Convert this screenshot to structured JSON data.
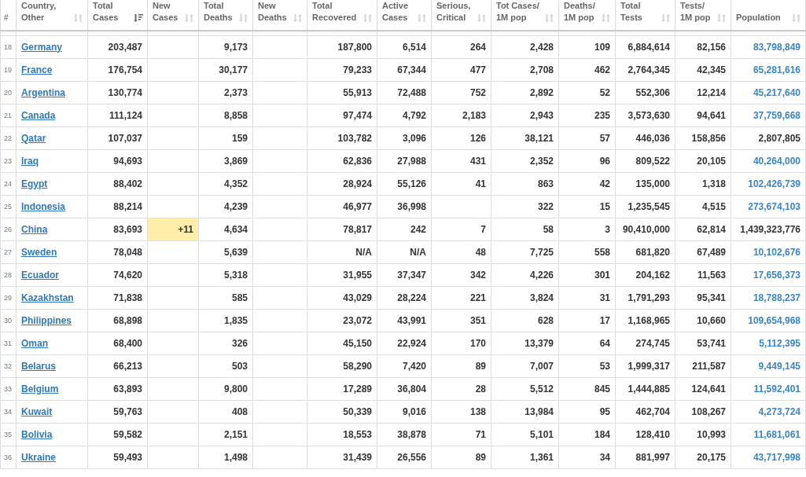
{
  "table": {
    "columns": [
      {
        "lines": [
          "#"
        ],
        "kind": "index"
      },
      {
        "lines": [
          "Country,",
          "Other"
        ],
        "kind": "data",
        "sorted": false
      },
      {
        "lines": [
          "Total",
          "Cases"
        ],
        "kind": "data",
        "sorted": true
      },
      {
        "lines": [
          "New",
          "Cases"
        ],
        "kind": "data",
        "sorted": false
      },
      {
        "lines": [
          "Total",
          "Deaths"
        ],
        "kind": "data",
        "sorted": false
      },
      {
        "lines": [
          "New",
          "Deaths"
        ],
        "kind": "data",
        "sorted": false
      },
      {
        "lines": [
          "Total",
          "Recovered"
        ],
        "kind": "data",
        "sorted": false
      },
      {
        "lines": [
          "Active",
          "Cases"
        ],
        "kind": "data",
        "sorted": false
      },
      {
        "lines": [
          "Serious,",
          "Critical"
        ],
        "kind": "data",
        "sorted": false
      },
      {
        "lines": [
          "Tot Cases/",
          "1M pop"
        ],
        "kind": "data",
        "sorted": false
      },
      {
        "lines": [
          "Deaths/",
          "1M pop"
        ],
        "kind": "data",
        "sorted": false
      },
      {
        "lines": [
          "Total",
          "Tests"
        ],
        "kind": "data",
        "sorted": false
      },
      {
        "lines": [
          "Tests/",
          "1M pop"
        ],
        "kind": "data",
        "sorted": false
      },
      {
        "lines": [
          "Population"
        ],
        "kind": "data",
        "sorted": false
      }
    ],
    "rows": [
      {
        "rank": "18",
        "country": "Germany",
        "total_cases": "203,487",
        "total_deaths": "9,173",
        "total_recovered": "187,800",
        "active_cases": "6,514",
        "serious_critical": "264",
        "cases_per_1m": "2,428",
        "deaths_per_1m": "109",
        "total_tests": "6,884,614",
        "tests_per_1m": "82,156",
        "population": "83,798,849",
        "population_link": true
      },
      {
        "rank": "19",
        "country": "France",
        "total_cases": "176,754",
        "total_deaths": "30,177",
        "total_recovered": "79,233",
        "active_cases": "67,344",
        "serious_critical": "477",
        "cases_per_1m": "2,708",
        "deaths_per_1m": "462",
        "total_tests": "2,764,345",
        "tests_per_1m": "42,345",
        "population": "65,281,616",
        "population_link": true
      },
      {
        "rank": "20",
        "country": "Argentina",
        "total_cases": "130,774",
        "total_deaths": "2,373",
        "total_recovered": "55,913",
        "active_cases": "72,488",
        "serious_critical": "752",
        "cases_per_1m": "2,892",
        "deaths_per_1m": "52",
        "total_tests": "552,306",
        "tests_per_1m": "12,214",
        "population": "45,217,640",
        "population_link": true
      },
      {
        "rank": "21",
        "country": "Canada",
        "total_cases": "111,124",
        "total_deaths": "8,858",
        "total_recovered": "97,474",
        "active_cases": "4,792",
        "serious_critical": "2,183",
        "cases_per_1m": "2,943",
        "deaths_per_1m": "235",
        "total_tests": "3,573,630",
        "tests_per_1m": "94,641",
        "population": "37,759,668",
        "population_link": true
      },
      {
        "rank": "22",
        "country": "Qatar",
        "total_cases": "107,037",
        "total_deaths": "159",
        "total_recovered": "103,782",
        "active_cases": "3,096",
        "serious_critical": "126",
        "cases_per_1m": "38,121",
        "deaths_per_1m": "57",
        "total_tests": "446,036",
        "tests_per_1m": "158,856",
        "population": "2,807,805",
        "population_link": false
      },
      {
        "rank": "23",
        "country": "Iraq",
        "total_cases": "94,693",
        "total_deaths": "3,869",
        "total_recovered": "62,836",
        "active_cases": "27,988",
        "serious_critical": "431",
        "cases_per_1m": "2,352",
        "deaths_per_1m": "96",
        "total_tests": "809,522",
        "tests_per_1m": "20,105",
        "population": "40,264,000",
        "population_link": true
      },
      {
        "rank": "24",
        "country": "Egypt",
        "total_cases": "88,402",
        "total_deaths": "4,352",
        "total_recovered": "28,924",
        "active_cases": "55,126",
        "serious_critical": "41",
        "cases_per_1m": "863",
        "deaths_per_1m": "42",
        "total_tests": "135,000",
        "tests_per_1m": "1,318",
        "population": "102,426,739",
        "population_link": true
      },
      {
        "rank": "25",
        "country": "Indonesia",
        "total_cases": "88,214",
        "total_deaths": "4,239",
        "total_recovered": "46,977",
        "active_cases": "36,998",
        "cases_per_1m": "322",
        "deaths_per_1m": "15",
        "total_tests": "1,235,545",
        "tests_per_1m": "4,515",
        "population": "273,674,103",
        "population_link": true
      },
      {
        "rank": "26",
        "country": "China",
        "total_cases": "83,693",
        "new_cases": "+11",
        "total_deaths": "4,634",
        "total_recovered": "78,817",
        "active_cases": "242",
        "serious_critical": "7",
        "cases_per_1m": "58",
        "deaths_per_1m": "3",
        "total_tests": "90,410,000",
        "tests_per_1m": "62,814",
        "population": "1,439,323,776",
        "population_link": false
      },
      {
        "rank": "27",
        "country": "Sweden",
        "total_cases": "78,048",
        "total_deaths": "5,639",
        "total_recovered": "N/A",
        "active_cases": "N/A",
        "serious_critical": "48",
        "cases_per_1m": "7,725",
        "deaths_per_1m": "558",
        "total_tests": "681,820",
        "tests_per_1m": "67,489",
        "population": "10,102,676",
        "population_link": true
      },
      {
        "rank": "28",
        "country": "Ecuador",
        "total_cases": "74,620",
        "total_deaths": "5,318",
        "total_recovered": "31,955",
        "active_cases": "37,347",
        "serious_critical": "342",
        "cases_per_1m": "4,226",
        "deaths_per_1m": "301",
        "total_tests": "204,162",
        "tests_per_1m": "11,563",
        "population": "17,656,373",
        "population_link": true
      },
      {
        "rank": "29",
        "country": "Kazakhstan",
        "total_cases": "71,838",
        "total_deaths": "585",
        "total_recovered": "43,029",
        "active_cases": "28,224",
        "serious_critical": "221",
        "cases_per_1m": "3,824",
        "deaths_per_1m": "31",
        "total_tests": "1,791,293",
        "tests_per_1m": "95,341",
        "population": "18,788,237",
        "population_link": true
      },
      {
        "rank": "30",
        "country": "Philippines",
        "total_cases": "68,898",
        "total_deaths": "1,835",
        "total_recovered": "23,072",
        "active_cases": "43,991",
        "serious_critical": "351",
        "cases_per_1m": "628",
        "deaths_per_1m": "17",
        "total_tests": "1,168,965",
        "tests_per_1m": "10,660",
        "population": "109,654,968",
        "population_link": true
      },
      {
        "rank": "31",
        "country": "Oman",
        "total_cases": "68,400",
        "total_deaths": "326",
        "total_recovered": "45,150",
        "active_cases": "22,924",
        "serious_critical": "170",
        "cases_per_1m": "13,379",
        "deaths_per_1m": "64",
        "total_tests": "274,745",
        "tests_per_1m": "53,741",
        "population": "5,112,395",
        "population_link": true
      },
      {
        "rank": "32",
        "country": "Belarus",
        "total_cases": "66,213",
        "total_deaths": "503",
        "total_recovered": "58,290",
        "active_cases": "7,420",
        "serious_critical": "89",
        "cases_per_1m": "7,007",
        "deaths_per_1m": "53",
        "total_tests": "1,999,317",
        "tests_per_1m": "211,587",
        "population": "9,449,145",
        "population_link": true
      },
      {
        "rank": "33",
        "country": "Belgium",
        "total_cases": "63,893",
        "total_deaths": "9,800",
        "total_recovered": "17,289",
        "active_cases": "36,804",
        "serious_critical": "28",
        "cases_per_1m": "5,512",
        "deaths_per_1m": "845",
        "total_tests": "1,444,885",
        "tests_per_1m": "124,641",
        "population": "11,592,401",
        "population_link": true
      },
      {
        "rank": "34",
        "country": "Kuwait",
        "total_cases": "59,763",
        "total_deaths": "408",
        "total_recovered": "50,339",
        "active_cases": "9,016",
        "serious_critical": "138",
        "cases_per_1m": "13,984",
        "deaths_per_1m": "95",
        "total_tests": "462,704",
        "tests_per_1m": "108,267",
        "population": "4,273,724",
        "population_link": true
      },
      {
        "rank": "35",
        "country": "Bolivia",
        "total_cases": "59,582",
        "total_deaths": "2,151",
        "total_recovered": "18,553",
        "active_cases": "38,878",
        "serious_critical": "71",
        "cases_per_1m": "5,101",
        "deaths_per_1m": "184",
        "total_tests": "128,410",
        "tests_per_1m": "10,993",
        "population": "11,681,061",
        "population_link": true
      },
      {
        "rank": "36",
        "country": "Ukraine",
        "total_cases": "59,493",
        "total_deaths": "1,498",
        "total_recovered": "31,439",
        "active_cases": "26,556",
        "serious_critical": "89",
        "cases_per_1m": "1,361",
        "deaths_per_1m": "34",
        "total_tests": "881,997",
        "tests_per_1m": "20,175",
        "population": "43,717,998",
        "population_link": true
      }
    ]
  }
}
